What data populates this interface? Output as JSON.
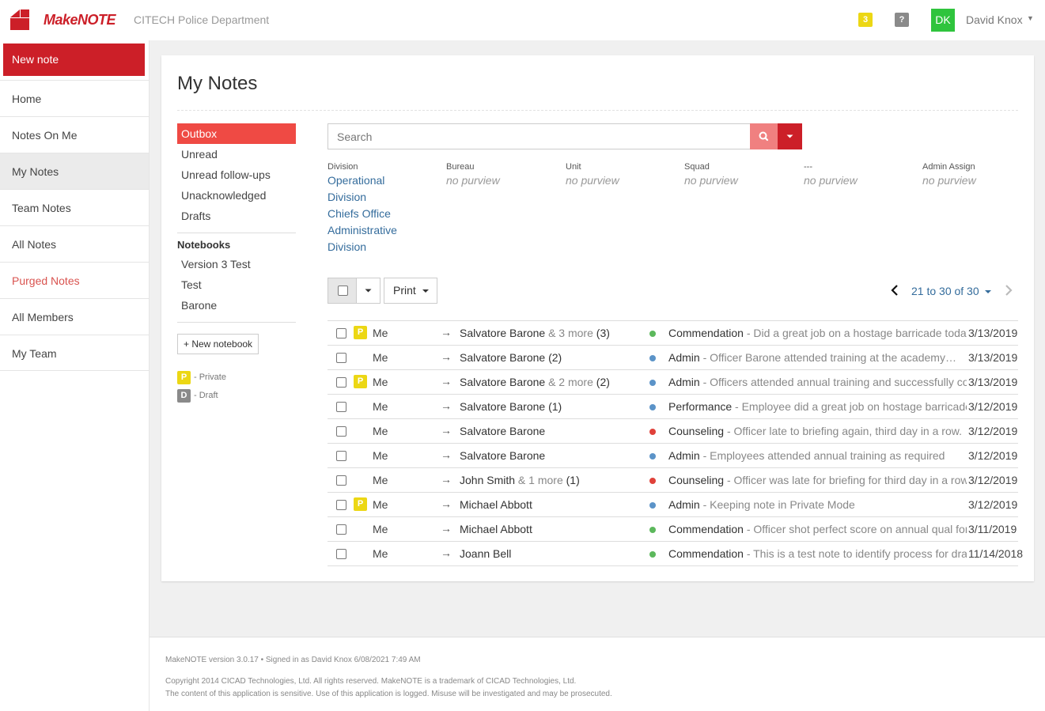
{
  "brand": {
    "logo_text": "MakeNOTE",
    "org_name": "CITECH Police Department",
    "accent": "#cc1f28"
  },
  "header": {
    "notification_count": "3",
    "help_label": "?",
    "avatar_initials": "DK",
    "user_name": "David Knox",
    "user_caret": "▼"
  },
  "sidebar": {
    "new_note_label": "New note",
    "items": [
      {
        "label": "Home"
      },
      {
        "label": "Notes On Me"
      },
      {
        "label": "My Notes"
      },
      {
        "label": "Team Notes"
      },
      {
        "label": "All Notes"
      },
      {
        "label": "Purged Notes"
      },
      {
        "label": "All Members"
      },
      {
        "label": "My Team"
      }
    ]
  },
  "main": {
    "title": "My Notes",
    "folders": [
      {
        "label": "Outbox"
      },
      {
        "label": "Unread"
      },
      {
        "label": "Unread follow-ups"
      },
      {
        "label": "Unacknowledged"
      },
      {
        "label": "Drafts"
      }
    ],
    "notebooks_heading": "Notebooks",
    "notebooks": [
      {
        "label": "Version 3 Test"
      },
      {
        "label": "Test"
      },
      {
        "label": "Barone"
      }
    ],
    "new_notebook_label": "+ New notebook",
    "legend": {
      "private_badge": "P",
      "private_label": "- Private",
      "draft_badge": "D",
      "draft_label": "- Draft"
    },
    "search": {
      "placeholder": "Search"
    },
    "purview": {
      "division_label": "Division",
      "division_values": [
        "Operational",
        "Division",
        "Chiefs Office",
        "Administrative",
        "Division"
      ],
      "bureau_label": "Bureau",
      "bureau_value": "no purview",
      "unit_label": "Unit",
      "unit_value": "no purview",
      "squad_label": "Squad",
      "squad_value": "no purview",
      "blank_label": "---",
      "blank_value": "no purview",
      "admin_label": "Admin Assign",
      "admin_value": "no purview"
    },
    "toolbar": {
      "print_label": "Print",
      "pager_text": "21 to 30 of 30"
    },
    "notes": [
      {
        "private": true,
        "from": "Me",
        "to": "Salvatore Barone",
        "more": " & 3 more",
        "count": " (3)",
        "category": "Commendation",
        "description": " - Did a great job on a hostage barricade today!",
        "date": "3/13/2019",
        "color": "#5cb85c"
      },
      {
        "private": false,
        "from": "Me",
        "to": "Salvatore Barone",
        "more": "",
        "count": " (2)",
        "category": "Admin",
        "description": " - Officer Barone attended training at the academy…",
        "date": "3/13/2019",
        "color": "#5b93c8"
      },
      {
        "private": true,
        "from": "Me",
        "to": "Salvatore Barone",
        "more": " & 2 more",
        "count": " (2)",
        "category": "Admin",
        "description": " - Officers attended annual training and successfully completed",
        "date": "3/13/2019",
        "color": "#5b93c8"
      },
      {
        "private": false,
        "from": "Me",
        "to": "Salvatore Barone",
        "more": "",
        "count": " (1)",
        "category": "Performance",
        "description": " - Employee did a great job on hostage barricade situation",
        "date": "3/12/2019",
        "color": "#5b93c8"
      },
      {
        "private": false,
        "from": "Me",
        "to": "Salvatore Barone",
        "more": "",
        "count": "",
        "category": "Counseling",
        "description": " - Officer late to briefing again, third day in a row.",
        "date": "3/12/2019",
        "color": "#e0413a"
      },
      {
        "private": false,
        "from": "Me",
        "to": "Salvatore Barone",
        "more": "",
        "count": "",
        "category": "Admin",
        "description": " - Employees attended annual training as required",
        "date": "3/12/2019",
        "color": "#5b93c8"
      },
      {
        "private": false,
        "from": "Me",
        "to": "John Smith",
        "more": " & 1 more",
        "count": " (1)",
        "category": "Counseling",
        "description": " - Officer was late for briefing for third day in a row",
        "date": "3/12/2019",
        "color": "#e0413a"
      },
      {
        "private": true,
        "from": "Me",
        "to": "Michael Abbott",
        "more": "",
        "count": "",
        "category": "Admin",
        "description": " - Keeping note in Private Mode",
        "date": "3/12/2019",
        "color": "#5b93c8"
      },
      {
        "private": false,
        "from": "Me",
        "to": "Michael Abbott",
        "more": "",
        "count": "",
        "category": "Commendation",
        "description": " - Officer shot perfect score on annual qual for third year",
        "date": "3/11/2019",
        "color": "#5cb85c"
      },
      {
        "private": false,
        "from": "Me",
        "to": "Joann Bell",
        "more": "",
        "count": "",
        "category": "Commendation",
        "description": " - This is a test note to identify process for draft notes",
        "date": "11/14/2018",
        "color": "#5cb85c"
      }
    ],
    "arrow_glyph": "→",
    "private_badge": "P"
  },
  "footer": {
    "version_line": "MakeNOTE version 3.0.17 • Signed in as David Knox 6/08/2021 7:49 AM",
    "copyright_line": "Copyright 2014 CICAD Technologies, Ltd. All rights reserved. MakeNOTE is a trademark of CICAD Technologies, Ltd.",
    "notice_line": "The content of this application is sensitive. Use of this application is logged. Misuse will be investigated and may be prosecuted."
  }
}
